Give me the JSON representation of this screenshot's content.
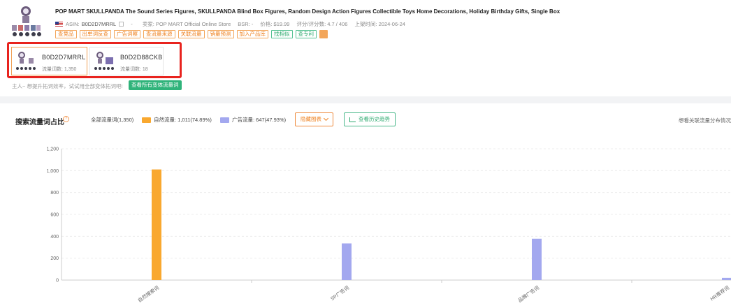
{
  "product": {
    "title": "POP MART SKULLPANDA The Sound Series Figures, SKULLPANDA Blind Box Figures, Random Design Action Figures Collectible Toys Home Decorations, Holiday Birthday Gifts, Single Box",
    "asin_label": "ASIN:",
    "asin": "B0D2D7MRRL",
    "dash": "-",
    "seller": "卖家: POP MART Official Online Store",
    "bsr": "BSR: -",
    "price": "价格: $19.99",
    "rating": "评分/评分数: 4.7 / 406",
    "launch": "上架时间: 2024-06-24"
  },
  "tags": [
    {
      "label": "查竞品",
      "style": "orange"
    },
    {
      "label": "出单词反查",
      "style": "orange"
    },
    {
      "label": "广告词察",
      "style": "orange"
    },
    {
      "label": "查流量来源",
      "style": "orange"
    },
    {
      "label": "关联流量",
      "style": "orange"
    },
    {
      "label": "销量预测",
      "style": "orange"
    },
    {
      "label": "加入产品库",
      "style": "orange"
    },
    {
      "label": "找相似",
      "style": "green"
    },
    {
      "label": "查专利",
      "style": "green"
    }
  ],
  "variants": [
    {
      "asin": "B0D2D7MRRL",
      "count": "流量词数: 1,350"
    },
    {
      "asin": "B0D2D88CKB",
      "count": "流量词数: 18"
    }
  ],
  "hint": "主人~ 想提升拓词效率，试试用全部变体拓词吧!",
  "view_all_button": "查看所有变体流量词",
  "chart_section": {
    "title": "搜索流量词占比",
    "help": "?",
    "all_words": "全部流量词(1,350)",
    "legend_natural": "自然流量: 1,011(74.89%)",
    "legend_ad": "广告流量: 647(47.93%)",
    "hide_chart": "隐藏图表",
    "history_trend": "查看历史趋势",
    "right_note": "想看关联流量分布情况"
  },
  "colors": {
    "natural": "#f9a82f",
    "ad": "#a3a8ef",
    "accent_orange": "#ee7f1c",
    "accent_green": "#2fb37a",
    "highlight_red": "#e8231e"
  },
  "chart_data": {
    "type": "bar",
    "categories": [
      "自然搜索词",
      "SP广告词",
      "品牌广告词",
      "HR推荐词"
    ],
    "series": [
      {
        "name": "自然流量",
        "values": [
          1011,
          null,
          null,
          null
        ]
      },
      {
        "name": "广告流量",
        "values": [
          null,
          335,
          378,
          20
        ]
      }
    ],
    "ylim": [
      0,
      1200
    ],
    "yticks": [
      "0",
      "200",
      "400",
      "600",
      "800",
      "1,000",
      "1,200"
    ],
    "grid": true
  }
}
